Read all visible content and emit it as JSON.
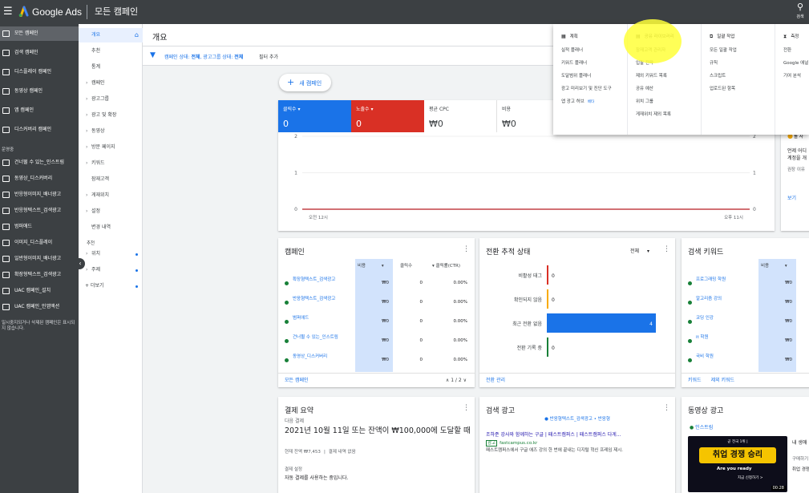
{
  "topbar": {
    "brand": "Google Ads",
    "page_title": "모든 캠페인",
    "search_label": "검색"
  },
  "leftnav": {
    "items": [
      {
        "label": "모든 캠페인",
        "selected": true
      },
      {
        "label": "검색 캠페인"
      },
      {
        "label": "디스플레이 캠페인"
      },
      {
        "label": "동영상 캠페인"
      },
      {
        "label": "앱 캠페인"
      },
      {
        "label": "디스커버리 캠페인"
      }
    ],
    "section_label": "운영중",
    "campaigns": [
      "건너뛸 수 있는_인스트림",
      "동영상_디스커버리",
      "반응형이미지_배너광고",
      "반응형텍스트_검색광고",
      "범퍼애드",
      "이미지_디스플레이",
      "일반형이미지_배너광고",
      "확장형텍스트_검색광고",
      "UAC 캠페인_설치",
      "UAC 캠페인_인앱액션"
    ],
    "note": "일시중지되거나 삭제된 캠페인은 표시되지 않습니다."
  },
  "subnav": {
    "items": [
      {
        "label": "개요",
        "selected": true,
        "arrow": false
      },
      {
        "label": "추천",
        "arrow": false
      },
      {
        "label": "통계",
        "arrow": false
      },
      {
        "label": "캠페인",
        "arrow": true
      },
      {
        "label": "광고그룹",
        "arrow": true
      },
      {
        "label": "광고 및 확장",
        "arrow": true
      },
      {
        "label": "동영상",
        "arrow": true
      },
      {
        "label": "방문 페이지",
        "arrow": true
      },
      {
        "label": "키워드",
        "arrow": true
      },
      {
        "label": "잠재고객",
        "arrow": false
      },
      {
        "label": "게재위치",
        "arrow": true
      },
      {
        "label": "설정",
        "arrow": true
      },
      {
        "label": "변경 내역",
        "arrow": false
      }
    ],
    "extra_section": "추천",
    "extra_items": [
      {
        "label": "위치",
        "arrow": true
      },
      {
        "label": "주제",
        "arrow": true
      },
      {
        "label": "더보기",
        "plus": true
      }
    ]
  },
  "main": {
    "title": "개요",
    "filter_prefix": "캠페인 상태: ",
    "filter_all1": "전체",
    "filter_mid": ", 광고그룹 상태: ",
    "filter_all2": "전체",
    "filter_add": "필터 추가",
    "new_campaign": "새 캠페인"
  },
  "metrics": [
    {
      "label": "클릭수 ▾",
      "value": "0",
      "color": "#1a73e8"
    },
    {
      "label": "노출수 ▾",
      "value": "0",
      "color": "#d93025"
    },
    {
      "label": "평균 CPC",
      "value": "₩0",
      "color": "#ffffff"
    },
    {
      "label": "비용",
      "value": "₩0",
      "color": "#ffffff"
    }
  ],
  "chart_data": {
    "type": "line",
    "x_labels": [
      "오전 12시",
      "오후 11시"
    ],
    "left_ticks": [
      "2",
      "1",
      "0"
    ],
    "right_ticks": [
      "2",
      "1",
      "0"
    ],
    "ylim": [
      0,
      2
    ],
    "series": [
      {
        "values": [
          0,
          0
        ],
        "color": "#d93025"
      },
      {
        "values": [
          0,
          0
        ],
        "color": "#1a73e8"
      }
    ]
  },
  "campaign_card": {
    "title": "캠페인",
    "col_cost": "비용",
    "col_clicks": "클릭수",
    "col_ctr": "클릭률(CTR)",
    "rows": [
      {
        "name": "확장형텍스트_검색광고",
        "cost": "₩0",
        "clicks": "0",
        "ctr": "0.00%"
      },
      {
        "name": "반응형텍스트_검색광고",
        "cost": "₩0",
        "clicks": "0",
        "ctr": "0.00%"
      },
      {
        "name": "범퍼애드",
        "cost": "₩0",
        "clicks": "0",
        "ctr": "0.00%"
      },
      {
        "name": "건너뛸 수 있는_인스트림",
        "cost": "₩0",
        "clicks": "0",
        "ctr": "0.00%"
      },
      {
        "name": "동영상_디스커버리",
        "cost": "₩0",
        "clicks": "0",
        "ctr": "0.00%"
      }
    ],
    "footer": "모든 캠페인",
    "pager": "1 / 2"
  },
  "conversion_card": {
    "title": "전환 추적 상태",
    "filter": "전체",
    "rows": [
      {
        "label": "비활성 태그",
        "value": 0,
        "color": "#d93025"
      },
      {
        "label": "확인되지 않음",
        "value": 0,
        "color": "#f9ab00"
      },
      {
        "label": "최근 전환 없음",
        "value": 4,
        "color": "#1a73e8"
      },
      {
        "label": "전환 기록 중",
        "value": 0,
        "color": "#188038"
      }
    ],
    "max_value": 4,
    "footer": "전환 관리"
  },
  "keyword_card": {
    "title": "검색 키워드",
    "col_cost": "비용",
    "rows": [
      {
        "name": "프로그래밍 학원",
        "cost": "₩0"
      },
      {
        "name": "알고리즘 강의",
        "cost": "₩0"
      },
      {
        "name": "코딩 인강",
        "cost": "₩0"
      },
      {
        "name": "it 학원",
        "cost": "₩0"
      },
      {
        "name": "국비 학원",
        "cost": "₩0"
      }
    ],
    "footer1": "키워드",
    "footer2": "제외 키워드"
  },
  "billing_card": {
    "title": "결제 요약",
    "next_label": "다음 결제",
    "headline": "2021년 10월 11일 또는 잔액이 ₩100,000에 도달할 때",
    "balance_label": "현재 잔액 ",
    "balance": "₩7,453",
    "history_link": "결제 내역 없음",
    "settings_label": "결제 설정",
    "settings_text": "자동 결제를 사용하는 중입니다."
  },
  "search_ad_card": {
    "title": "검색 광고",
    "sub": "반응형텍스트_검색광고 • 반응형",
    "headline": "조하준 강사와 함께하는 구글 | 패스트캠퍼스 | 패스트캠퍼스 다게...",
    "badge": "광고",
    "url": "fastcampus.co.kr",
    "desc": "패스트캠퍼스에서 구글 애즈 강의 한 번에 끝내는 디지털 혁신 프레임 제시."
  },
  "video_card": {
    "title": "동영상 광고",
    "item": "인스트림",
    "thumb_text": "취업 경쟁 승리",
    "thumb_sub": "Are you ready",
    "thumb_badge": "곧 전국 1위 |",
    "thumb_btn": "지금 신청하기 >",
    "duration": "00:28",
    "side1": "내 생애",
    "side2": "구매하기",
    "side3": "취업 경쟁"
  },
  "side_panel": {
    "text1": "를 사",
    "text2": "언제 어디",
    "text3": "계정을 개",
    "text4": "권장 이유",
    "link": "보기"
  },
  "dropdown": {
    "columns": [
      {
        "icon": "calendar-icon",
        "title": "계획",
        "items": [
          "실적 플래너",
          "키워드 플래너",
          "도달범위 플래너",
          "광고 미리보기 및 진단 도구",
          "앱 광고 허브"
        ],
        "badge": "베타"
      },
      {
        "icon": "library-icon",
        "title": "공유 라이브러리",
        "items": [
          "잠재고객 관리자",
          "입찰 전략",
          "제외 키워드 목록",
          "공유 예산",
          "위치 그룹",
          "게재위치 제외 목록"
        ]
      },
      {
        "icon": "bulk-icon",
        "title": "일괄 작업",
        "items": [
          "모든 일괄 작업",
          "규칙",
          "스크립트",
          "업로드된 항목"
        ]
      },
      {
        "icon": "hourglass-icon",
        "title": "측정",
        "items": [
          "전환",
          "Google 애널",
          "기여 분석"
        ]
      }
    ]
  }
}
